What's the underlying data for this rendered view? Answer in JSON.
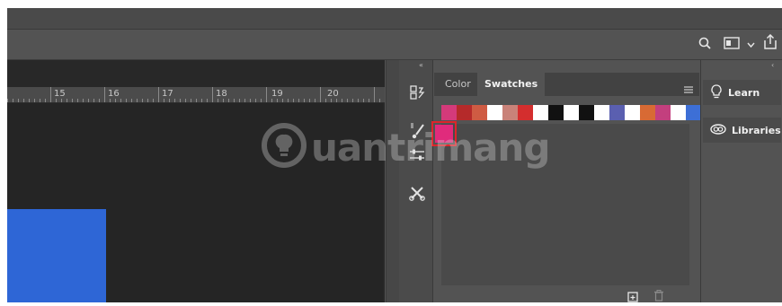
{
  "ruler": {
    "marks": [
      "15",
      "16",
      "17",
      "18",
      "19",
      "20"
    ]
  },
  "panel": {
    "tabs": [
      {
        "label": "Color"
      },
      {
        "label": "Swatches"
      }
    ],
    "swatches": [
      "#d43a7a",
      "#b52a2a",
      "#cf5b43",
      "#ffffff",
      "#c98279",
      "#d42e2e",
      "#ffffff",
      "#111111",
      "#ffffff",
      "#111111",
      "#ffffff",
      "#5a5fb0",
      "#ffffff",
      "#d86a34",
      "#c33f7e",
      "#ffffff",
      "#3d6fd6"
    ],
    "selected_swatch": "#e02b7c"
  },
  "right": {
    "learn": "Learn",
    "libraries": "Libraries"
  },
  "colors": {
    "accent_blue": "#2e66d6",
    "highlight": "#e0242a"
  },
  "watermark": {
    "text": "uantrimang"
  }
}
